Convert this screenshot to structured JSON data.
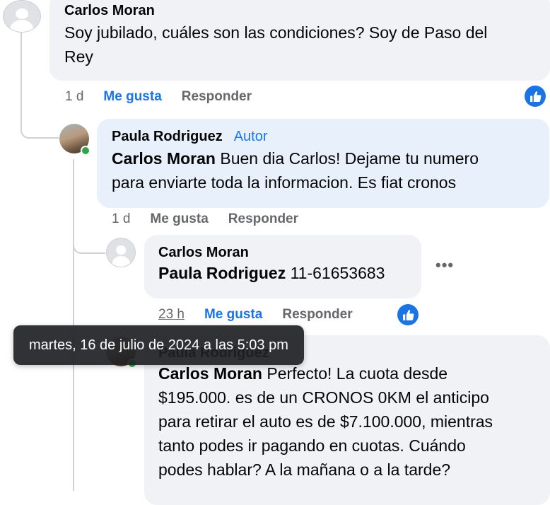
{
  "comments": [
    {
      "author": "Carlos Moran",
      "text_line1": "Soy jubilado, cuáles son las condiciones? Soy de Paso del",
      "text_line2": "Rey",
      "time": "1 d",
      "like_label": "Me gusta",
      "reply_label": "Responder"
    },
    {
      "author": "Paula Rodriguez",
      "author_badge": "Autor",
      "mention": "Carlos Moran",
      "text_line1_rest": " Buen dia Carlos! Dejame tu numero",
      "text_line2": "para enviarte toda la informacion. Es fiat cronos",
      "time": "1 d",
      "like_label": "Me gusta",
      "reply_label": "Responder"
    },
    {
      "author": "Carlos Moran",
      "mention": "Paula Rodriguez",
      "text_rest": " 11-61653683",
      "time": "23 h",
      "like_label": "Me gusta",
      "reply_label": "Responder",
      "more_label": "•••"
    },
    {
      "author": "Paula Rodriguez",
      "mention": "Carlos Moran",
      "text_line1_rest": " Perfecto! La cuota desde",
      "text_line2": "$195.000. es de un CRONOS 0KM el anticipo",
      "text_line3": "para retirar el auto es de $7.100.000, mientras",
      "text_line4": "tanto podes ir pagando en cuotas. Cuándo",
      "text_line5": "podes hablar? A la mañana o a la tarde?"
    }
  ],
  "tooltip": "martes, 16 de julio de 2024 a las 5:03 pm",
  "colors": {
    "bubble": "#f0f2f5",
    "bubble_highlight": "#e8f1fb",
    "like_blue": "#1b74e4",
    "meta_gray": "#65676b"
  },
  "icons": {
    "like_badge": "thumbs-up-icon",
    "avatar_placeholder": "default-avatar-icon"
  }
}
